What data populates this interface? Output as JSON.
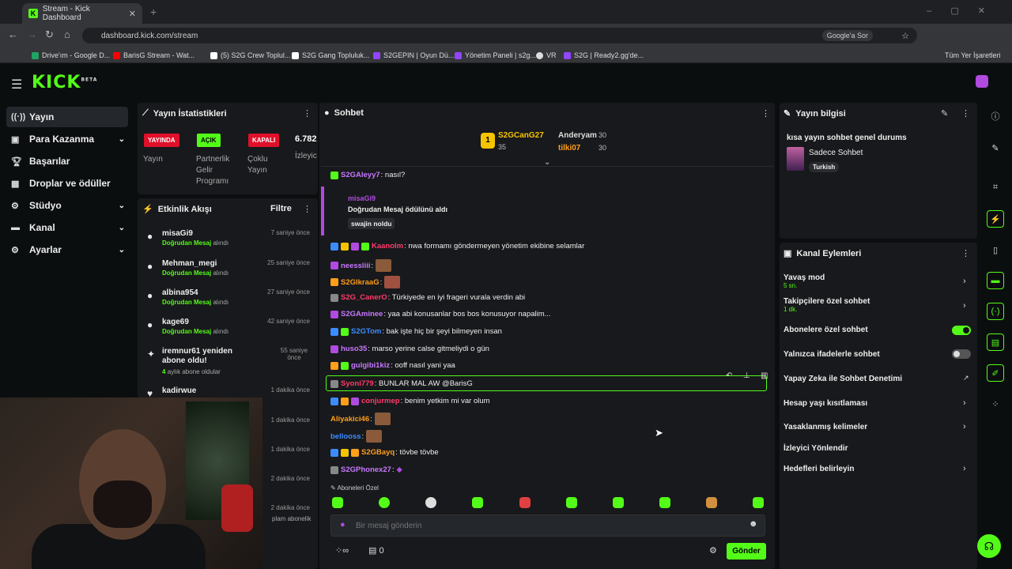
{
  "browser": {
    "tab_title": "Stream - Kick Dashboard",
    "url": "dashboard.kick.com/stream",
    "google_btn": "Google'a Sor",
    "bookmarks": [
      "Drive'ım - Google D...",
      "BarisG Stream - Wat...",
      "(5) S2G Crew Toplul...",
      "S2G Gang Topluluk...",
      "S2GEPIN | Oyun Dü...",
      "Yönetim Paneli | s2g...",
      "VR",
      "S2G | Ready2.gg'de..."
    ],
    "all_bookmarks": "Tüm Yer İşaretleri"
  },
  "logo": "KICK",
  "logo_beta": "BETA",
  "sidebar": {
    "items": [
      {
        "label": "Yayın"
      },
      {
        "label": "Para Kazanma"
      },
      {
        "label": "Başarılar"
      },
      {
        "label": "Droplar ve ödüller"
      },
      {
        "label": "Stüdyo"
      },
      {
        "label": "Kanal"
      },
      {
        "label": "Ayarlar"
      }
    ]
  },
  "stats": {
    "title": "Yayın İstatistikleri",
    "live_badge": "YAYINDA",
    "partner_badge": "AÇIK",
    "multi_badge": "KAPALI",
    "viewers": "6.782",
    "labels": {
      "stream": "Yayın",
      "partner1": "Partnerlik",
      "partner2": "Gelir",
      "partner3": "Programı",
      "multi1": "Çoklu",
      "multi2": "Yayın",
      "viewers": "İzleyic"
    }
  },
  "activity": {
    "title": "Etkinlik Akışı",
    "filter": "Filtre",
    "items": [
      {
        "name": "misaGi9",
        "time": "7 saniye önce",
        "reward": "Doğrudan Mesaj",
        "suffix": "alındı"
      },
      {
        "name": "Mehman_megi",
        "time": "25 saniye önce",
        "reward": "Doğrudan Mesaj",
        "suffix": "alındı"
      },
      {
        "name": "albina954",
        "time": "27 saniye önce",
        "reward": "Doğrudan Mesaj",
        "suffix": "alındı"
      },
      {
        "name": "kage69",
        "time": "42 saniye önce",
        "reward": "Doğrudan Mesaj",
        "suffix": "alındı"
      },
      {
        "name": "iremnur61 yeniden abone oldu!",
        "time": "55 saniye önce",
        "reward": "4",
        "suffix": "aylık abone oldular"
      },
      {
        "name": "kadirwue",
        "time": "1 dakika önce"
      },
      {
        "time": "1 dakika önce"
      },
      {
        "time": "1 dakika önce"
      },
      {
        "time": "2 dakika önce"
      },
      {
        "time": "2 dakika önce",
        "suffix": "plam abonelik"
      }
    ]
  },
  "chat": {
    "title": "Sohbet",
    "leader1": {
      "name": "S2GCanG27",
      "count": "35"
    },
    "leader2": {
      "name": "Anderyam",
      "count": "30"
    },
    "leader3": {
      "name": "tilki07",
      "count": "30"
    },
    "reward_user": "misaGi9",
    "reward_text": "Doğrudan Mesaj ödülünü aldı",
    "reward_note": "swajin noldu",
    "messages": [
      {
        "user": "S2GAleyy7",
        "text": ": nasıl?",
        "color": "#c678ff"
      },
      {
        "user": "Kaanolm",
        "text": ": nwa formamı göndermeyen yönetim ekibine selamlar",
        "color": "#ff3b6b"
      },
      {
        "user": "neessliii",
        "text": ":",
        "color": "#c678ff"
      },
      {
        "user": "S2GlkraaG",
        "text": ":",
        "color": "#ff9f1a"
      },
      {
        "user": "S2G_CanerO",
        "text": ": Türkiyede en iyi frageri vurala verdin abi",
        "color": "#ff3b6b"
      },
      {
        "user": "S2GAminee",
        "text": ": yaa abi konusanlar bos bos konusuyor napalim...",
        "color": "#c678ff"
      },
      {
        "user": "S2GTom",
        "text": ": bak işte hiç bir şeyi bilmeyen insan",
        "color": "#3b8cff"
      },
      {
        "user": "huso35",
        "text": ": marso yerine calse gitmeliydi o gün",
        "color": "#c678ff"
      },
      {
        "user": "gulgibi1kiz",
        "text": ": ooff nasıl yani yaa",
        "color": "#c678ff"
      },
      {
        "user": "Syoni779",
        "text": ": BUNLAR MAL AW @BarisG",
        "color": "#ff3b6b"
      },
      {
        "user": "conjurmep",
        "text": ": benim yetkim mi var olum",
        "color": "#ff3b6b"
      },
      {
        "user": "Aliyakici46",
        "text": ":",
        "color": "#ff9f1a"
      },
      {
        "user": "bellooss",
        "text": ":",
        "color": "#3b8cff"
      },
      {
        "user": "S2GBayq",
        "text": ": tövbe tövbe",
        "color": "#ff9f1a"
      },
      {
        "user": "S2GPhonex27",
        "text": ":",
        "color": "#c678ff"
      }
    ],
    "sub_only": "Aboneleri Özel",
    "input_placeholder": "Bir mesaj gönderin",
    "count": "0",
    "send": "Gönder"
  },
  "info": {
    "title": "Yayın bilgisi",
    "stream_title": "kısa yayın sohbet genel durums",
    "category": "Sadece Sohbet",
    "tag": "Turkish"
  },
  "actions": {
    "title": "Kanal Eylemleri",
    "items": [
      {
        "label": "Yavaş mod",
        "sub": "5 sn."
      },
      {
        "label": "Takipçilere özel sohbet",
        "sub": "1 dk."
      },
      {
        "label": "Abonelere özel sohbet"
      },
      {
        "label": "Yalnızca ifadelerle sohbet"
      },
      {
        "label": "Yapay Zeka ile Sohbet Denetimi"
      },
      {
        "label": "Hesap yaşı kısıtlaması"
      },
      {
        "label": "Yasaklanmış kelimeler"
      },
      {
        "label": "İzleyici Yönlendir"
      },
      {
        "label": "Hedefleri belirleyin"
      }
    ]
  },
  "colors": {
    "accent": "#53fc18",
    "live": "#e0102a"
  }
}
